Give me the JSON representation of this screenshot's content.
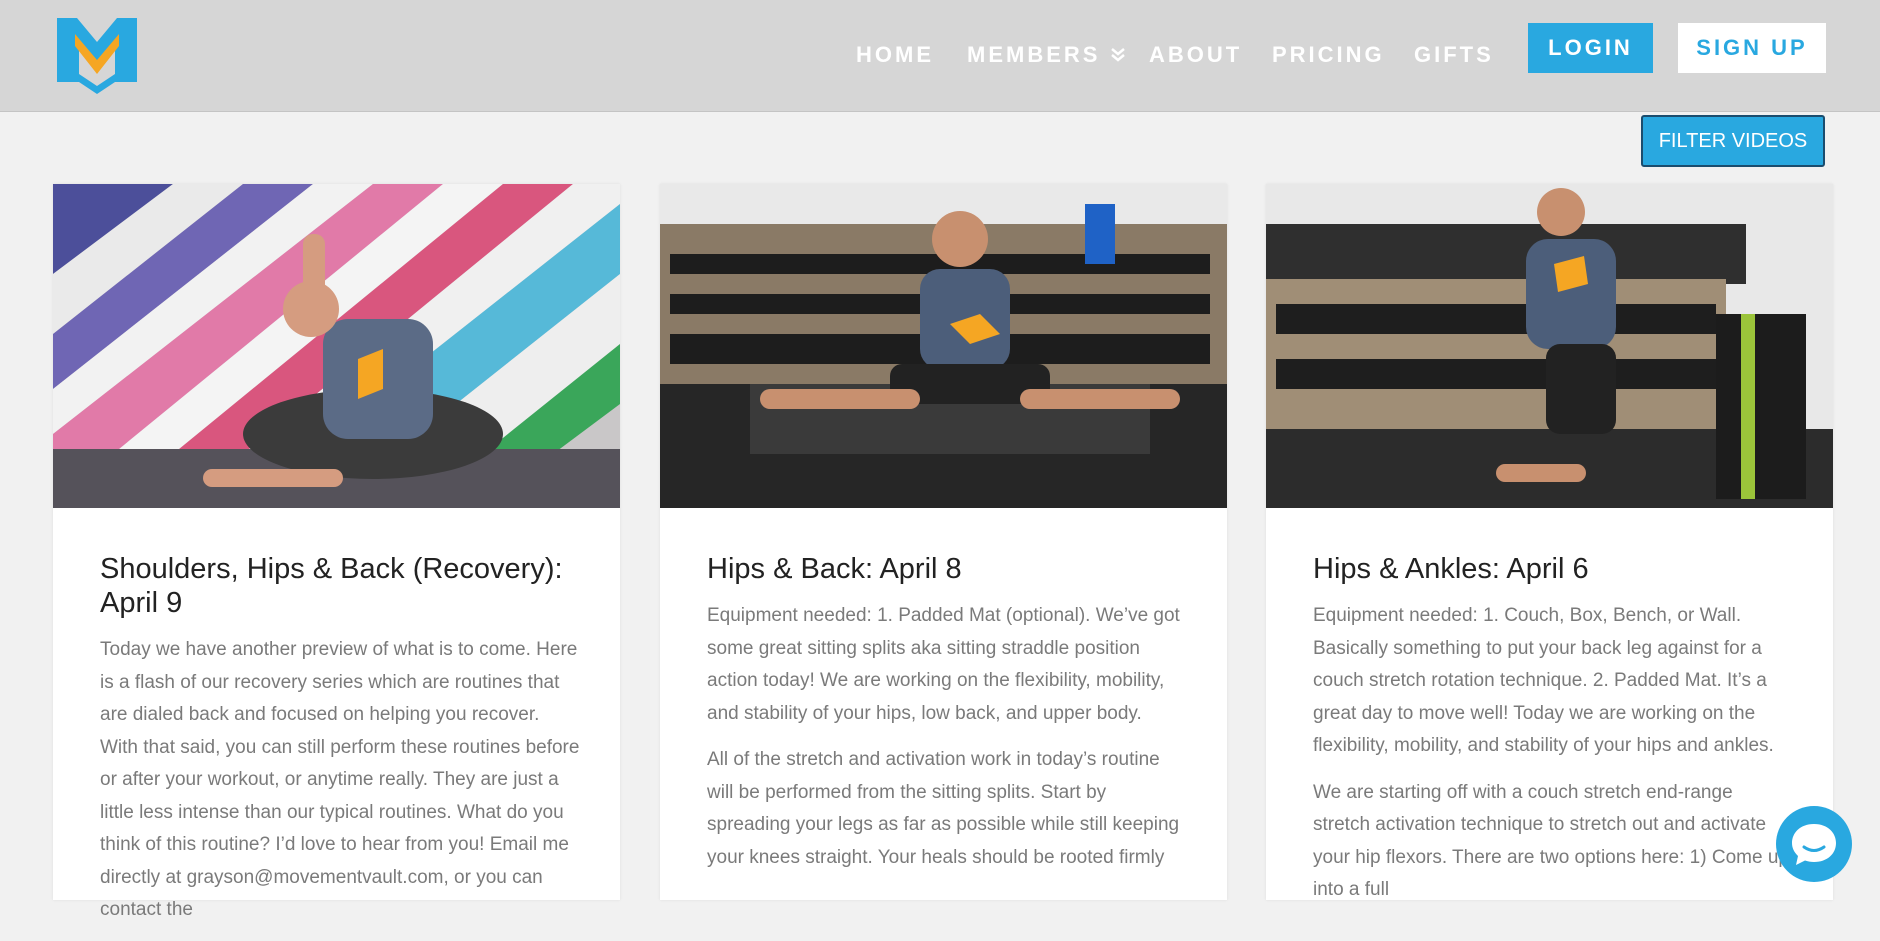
{
  "brand": {
    "logo": "M",
    "accent": "#29a8e0",
    "logo_orange": "#f5a623"
  },
  "nav": {
    "items": [
      {
        "label": "HOME"
      },
      {
        "label": "MEMBERS"
      },
      {
        "label": "ABOUT"
      },
      {
        "label": "PRICING"
      },
      {
        "label": "GIFTS"
      }
    ],
    "login_label": "LOGIN",
    "signup_label": "SIGN UP"
  },
  "filter_label": "FILTER VIDEOS",
  "cards": [
    {
      "title": "Shoulders, Hips & Back (Recovery): April 9",
      "paragraphs": [
        "Today we have another preview of what is to come. Here is a flash of our recovery series which are routines that are dialed back and focused on helping you recover. With that said, you can still perform these routines before or after your workout, or anytime really. They are just a little less intense than our typical routines. What do you think of this routine? I’d love to hear from you! Email me directly at grayson@movementvault.com, or you can contact the"
      ]
    },
    {
      "title": "Hips & Back: April 8",
      "paragraphs": [
        "Equipment needed: 1. Padded Mat (optional). We’ve got some great sitting splits aka sitting straddle position action today! We are working on the flexibility, mobility, and stability of your hips, low back, and upper body.",
        "All of the stretch and activation work in today’s routine will be performed from the sitting splits. Start by spreading your legs as far as possible while still keeping your knees straight. Your heals should be rooted firmly"
      ]
    },
    {
      "title": "Hips & Ankles: April 6",
      "paragraphs": [
        "Equipment needed: 1. Couch, Box, Bench, or Wall. Basically something to put your back leg against for a couch stretch rotation technique. 2. Padded Mat. It’s a great day to move well! Today we are working on the flexibility, mobility, and stability of your hips and ankles.",
        "We are starting off with a couch stretch end-range stretch activation technique to stretch out and activate your hip flexors. There are two options here: 1) Come up into a full"
      ]
    }
  ],
  "icons": {
    "members_chevron": "chevron-double-down-icon",
    "chat": "chat-bubble-icon"
  }
}
